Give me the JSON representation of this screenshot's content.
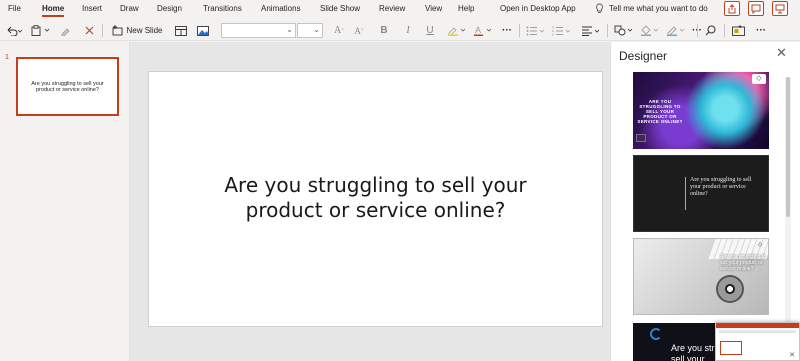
{
  "menu": {
    "items": [
      "File",
      "Home",
      "Insert",
      "Draw",
      "Design",
      "Transitions",
      "Animations",
      "Slide Show",
      "Review",
      "View",
      "Help",
      "Open in Desktop App"
    ],
    "active": "Home",
    "tell_me": "Tell me what you want to do"
  },
  "toolbar": {
    "new_slide": "New Slide",
    "font_name": "",
    "font_size": ""
  },
  "thumbnails": [
    {
      "number": "1",
      "text": "Are you struggling to sell your product or service online?"
    }
  ],
  "slide": {
    "title": "Are you struggling to sell your product or service online?"
  },
  "designer": {
    "title": "Designer",
    "designs": [
      {
        "style": "colorful-ink",
        "text": "ARE YOU STRUGGLING TO SELL YOUR PRODUCT OR SERVICE ONLINE?"
      },
      {
        "style": "dark-serif",
        "text": "Are you struggling to sell your product or service online?"
      },
      {
        "style": "gray-desk",
        "text": "Are you struggling to sell your product or service online?"
      },
      {
        "style": "dark-blue",
        "text": "Are you struggling to sell your"
      }
    ]
  },
  "colors": {
    "accent": "#c43e1c",
    "background": "#f3f2f1",
    "canvas": "#e6e6e6"
  }
}
